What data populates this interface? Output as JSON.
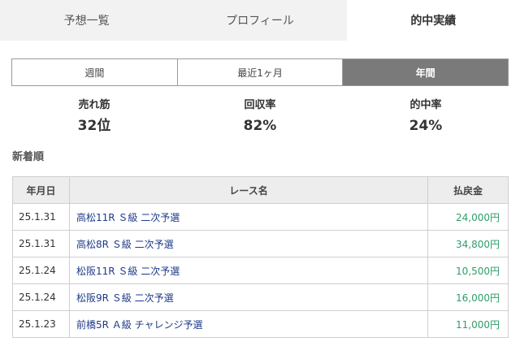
{
  "tabs": [
    {
      "label": "予想一覧",
      "active": false
    },
    {
      "label": "プロフィール",
      "active": false
    },
    {
      "label": "的中実績",
      "active": true
    }
  ],
  "periods": [
    {
      "label": "週間",
      "active": false
    },
    {
      "label": "最近1ヶ月",
      "active": false
    },
    {
      "label": "年間",
      "active": true
    }
  ],
  "stats": [
    {
      "label": "売れ筋",
      "value": "32位"
    },
    {
      "label": "回収率",
      "value": "82%"
    },
    {
      "label": "的中率",
      "value": "24%"
    }
  ],
  "section_title": "新着順",
  "table": {
    "headers": [
      "年月日",
      "レース名",
      "払戻金"
    ],
    "rows": [
      {
        "date": "25.1.31",
        "race": "高松11R Ｓ級 二次予選",
        "amount": "24,000円"
      },
      {
        "date": "25.1.31",
        "race": "高松8R Ｓ級 二次予選",
        "amount": "34,800円"
      },
      {
        "date": "25.1.24",
        "race": "松阪11R Ｓ級 二次予選",
        "amount": "10,500円"
      },
      {
        "date": "25.1.24",
        "race": "松阪9R Ｓ級 二次予選",
        "amount": "16,000円"
      },
      {
        "date": "25.1.23",
        "race": "前橋5R Ａ級 チャレンジ予選",
        "amount": "11,000円"
      }
    ]
  },
  "colors": {
    "accent_green": "#2e9e68",
    "link_blue": "#1e3a8a",
    "active_period": "#7a7a7a",
    "tab_bg": "#f2f2f2"
  }
}
